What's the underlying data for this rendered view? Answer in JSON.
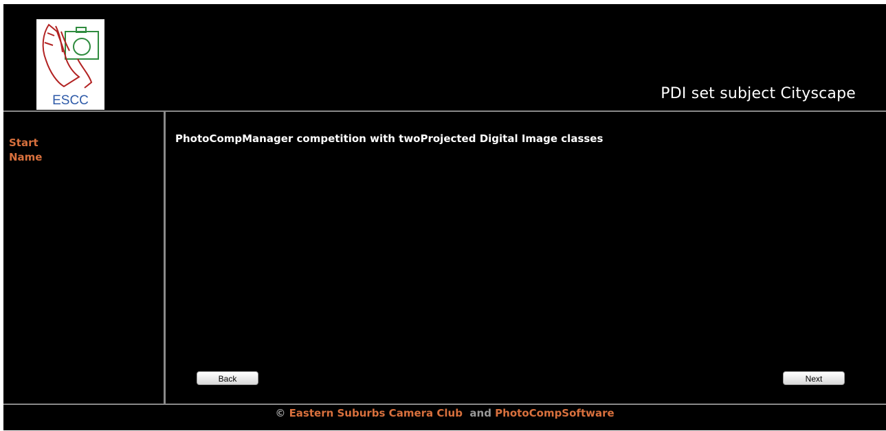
{
  "header": {
    "logo_text": "ESCC",
    "title": "PDI set subject Cityscape"
  },
  "sidebar": {
    "items": [
      {
        "label": "Start"
      },
      {
        "label": "Name"
      }
    ]
  },
  "main": {
    "description": "PhotoCompManager competition with twoProjected Digital Image classes",
    "back_label": "Back",
    "next_label": "Next"
  },
  "footer": {
    "copyright_symbol": "©",
    "club_link": "Eastern Suburbs Camera Club",
    "conjunction": "and",
    "software_link": "PhotoCompSoftware"
  },
  "colors": {
    "background": "#000000",
    "link": "#d8703d",
    "divider": "#8a8a8a",
    "logo_text": "#2e5aa8"
  }
}
